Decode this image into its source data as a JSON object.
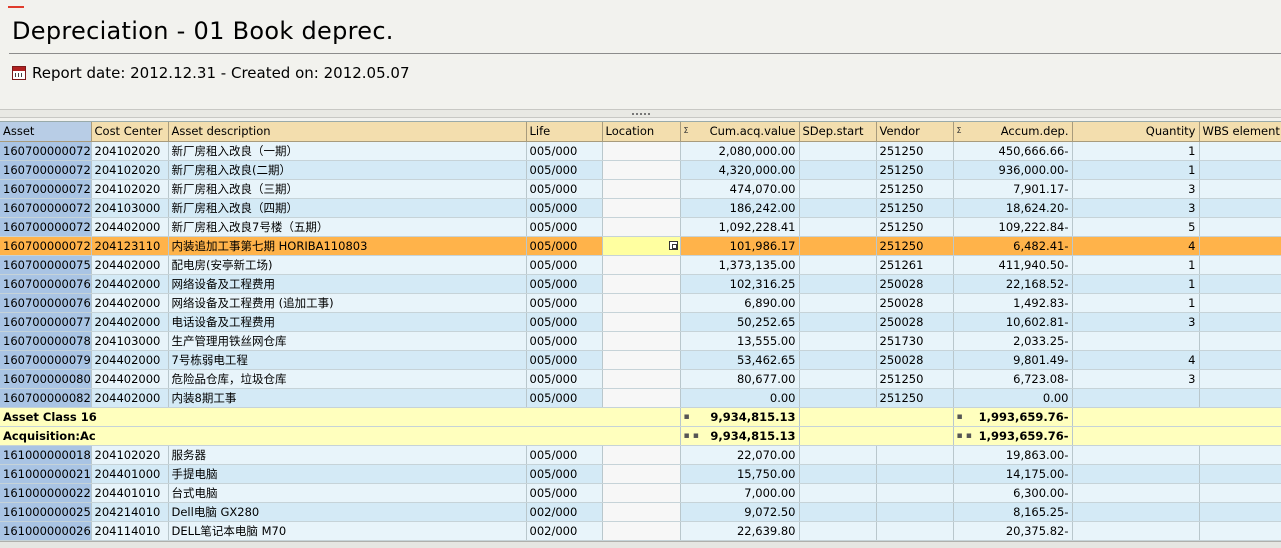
{
  "header": {
    "title": "Depreciation - 01 Book deprec.",
    "subtitle": "Report date: 2012.12.31 - Created on: 2012.05.07",
    "icon": "calendar-icon"
  },
  "table": {
    "columns": [
      "Asset",
      "Cost Center",
      "Asset description",
      "Life",
      "Location",
      "Cum.acq.value",
      "SDep.start",
      "Vendor",
      "Accum.dep.",
      "Quantity",
      "WBS element"
    ],
    "sum_marker": "Σ",
    "rows": [
      {
        "type": "data",
        "asset": "160700000072",
        "cc": "204102020",
        "desc": "新厂房租入改良（一期）",
        "life": "005/000",
        "loc": "",
        "acq": "2,080,000.00",
        "sdep": "",
        "vendor": "251250",
        "dep": "450,666.66-",
        "qty": "1",
        "wbs": ""
      },
      {
        "type": "data",
        "asset": "160700000072",
        "cc": "204102020",
        "desc": "新厂房租入改良(二期）",
        "life": "005/000",
        "loc": "",
        "acq": "4,320,000.00",
        "sdep": "",
        "vendor": "251250",
        "dep": "936,000.00-",
        "qty": "1",
        "wbs": ""
      },
      {
        "type": "data",
        "asset": "160700000072",
        "cc": "204102020",
        "desc": "新厂房租入改良（三期）",
        "life": "005/000",
        "loc": "",
        "acq": "474,070.00",
        "sdep": "",
        "vendor": "251250",
        "dep": "7,901.17-",
        "qty": "3",
        "wbs": ""
      },
      {
        "type": "data",
        "asset": "160700000072",
        "cc": "204103000",
        "desc": "新厂房租入改良（四期）",
        "life": "005/000",
        "loc": "",
        "acq": "186,242.00",
        "sdep": "",
        "vendor": "251250",
        "dep": "18,624.20-",
        "qty": "3",
        "wbs": ""
      },
      {
        "type": "data",
        "asset": "160700000072",
        "cc": "204402000",
        "desc": "新厂房租入改良7号楼（五期）",
        "life": "005/000",
        "loc": "",
        "acq": "1,092,228.41",
        "sdep": "",
        "vendor": "251250",
        "dep": "109,222.84-",
        "qty": "5",
        "wbs": ""
      },
      {
        "type": "selected",
        "asset": "160700000072",
        "cc": "204123110",
        "desc": "内装追加工事第七期  HORIBA110803",
        "life": "005/000",
        "loc": "",
        "acq": "101,986.17",
        "sdep": "",
        "vendor": "251250",
        "dep": "6,482.41-",
        "qty": "4",
        "wbs": ""
      },
      {
        "type": "data",
        "asset": "160700000075",
        "cc": "204402000",
        "desc": "配电房(安亭新工场)",
        "life": "005/000",
        "loc": "",
        "acq": "1,373,135.00",
        "sdep": "",
        "vendor": "251261",
        "dep": "411,940.50-",
        "qty": "1",
        "wbs": ""
      },
      {
        "type": "data",
        "asset": "160700000076",
        "cc": "204402000",
        "desc": "网络设备及工程费用",
        "life": "005/000",
        "loc": "",
        "acq": "102,316.25",
        "sdep": "",
        "vendor": "250028",
        "dep": "22,168.52-",
        "qty": "1",
        "wbs": ""
      },
      {
        "type": "data",
        "asset": "160700000076",
        "cc": "204402000",
        "desc": "网络设备及工程费用 (追加工事)",
        "life": "005/000",
        "loc": "",
        "acq": "6,890.00",
        "sdep": "",
        "vendor": "250028",
        "dep": "1,492.83-",
        "qty": "1",
        "wbs": ""
      },
      {
        "type": "data",
        "asset": "160700000077",
        "cc": "204402000",
        "desc": "电话设备及工程费用",
        "life": "005/000",
        "loc": "",
        "acq": "50,252.65",
        "sdep": "",
        "vendor": "250028",
        "dep": "10,602.81-",
        "qty": "3",
        "wbs": ""
      },
      {
        "type": "data",
        "asset": "160700000078",
        "cc": "204103000",
        "desc": "生产管理用铁丝网仓库",
        "life": "005/000",
        "loc": "",
        "acq": "13,555.00",
        "sdep": "",
        "vendor": "251730",
        "dep": "2,033.25-",
        "qty": "",
        "wbs": ""
      },
      {
        "type": "data",
        "asset": "160700000079",
        "cc": "204402000",
        "desc": "7号栋弱电工程",
        "life": "005/000",
        "loc": "",
        "acq": "53,462.65",
        "sdep": "",
        "vendor": "250028",
        "dep": "9,801.49-",
        "qty": "4",
        "wbs": ""
      },
      {
        "type": "data",
        "asset": "160700000080",
        "cc": "204402000",
        "desc": "危险品仓库，垃圾仓库",
        "life": "005/000",
        "loc": "",
        "acq": "80,677.00",
        "sdep": "",
        "vendor": "251250",
        "dep": "6,723.08-",
        "qty": "3",
        "wbs": ""
      },
      {
        "type": "data",
        "asset": "160700000082",
        "cc": "204402000",
        "desc": "内装8期工事",
        "life": "005/000",
        "loc": "",
        "acq": "0.00",
        "sdep": "",
        "vendor": "251250",
        "dep": "0.00",
        "qty": "",
        "wbs": ""
      },
      {
        "type": "sum",
        "label": "Asset Class 16",
        "acq": "9,934,815.13",
        "dep": "1,993,659.76-",
        "marker": "▪"
      },
      {
        "type": "sum",
        "label": "Acquisition:Ac",
        "acq": "9,934,815.13",
        "dep": "1,993,659.76-",
        "marker": "▪ ▪"
      },
      {
        "type": "data",
        "asset": "161000000018",
        "cc": "204102020",
        "desc": "服务器",
        "life": "005/000",
        "loc": "",
        "acq": "22,070.00",
        "sdep": "",
        "vendor": "",
        "dep": "19,863.00-",
        "qty": "",
        "wbs": ""
      },
      {
        "type": "data",
        "asset": "161000000021",
        "cc": "204401000",
        "desc": "手提电脑",
        "life": "005/000",
        "loc": "",
        "acq": "15,750.00",
        "sdep": "",
        "vendor": "",
        "dep": "14,175.00-",
        "qty": "",
        "wbs": ""
      },
      {
        "type": "data",
        "asset": "161000000022",
        "cc": "204401010",
        "desc": "台式电脑",
        "life": "005/000",
        "loc": "",
        "acq": "7,000.00",
        "sdep": "",
        "vendor": "",
        "dep": "6,300.00-",
        "qty": "",
        "wbs": ""
      },
      {
        "type": "data",
        "asset": "161000000025",
        "cc": "204214010",
        "desc": "Dell电脑 GX280",
        "life": "002/000",
        "loc": "",
        "acq": "9,072.50",
        "sdep": "",
        "vendor": "",
        "dep": "8,165.25-",
        "qty": "",
        "wbs": ""
      },
      {
        "type": "data",
        "asset": "161000000026",
        "cc": "204114010",
        "desc": "DELL笔记本电脑 M70",
        "life": "002/000",
        "loc": "",
        "acq": "22,639.80",
        "sdep": "",
        "vendor": "",
        "dep": "20,375.82-",
        "qty": "",
        "wbs": ""
      }
    ]
  }
}
